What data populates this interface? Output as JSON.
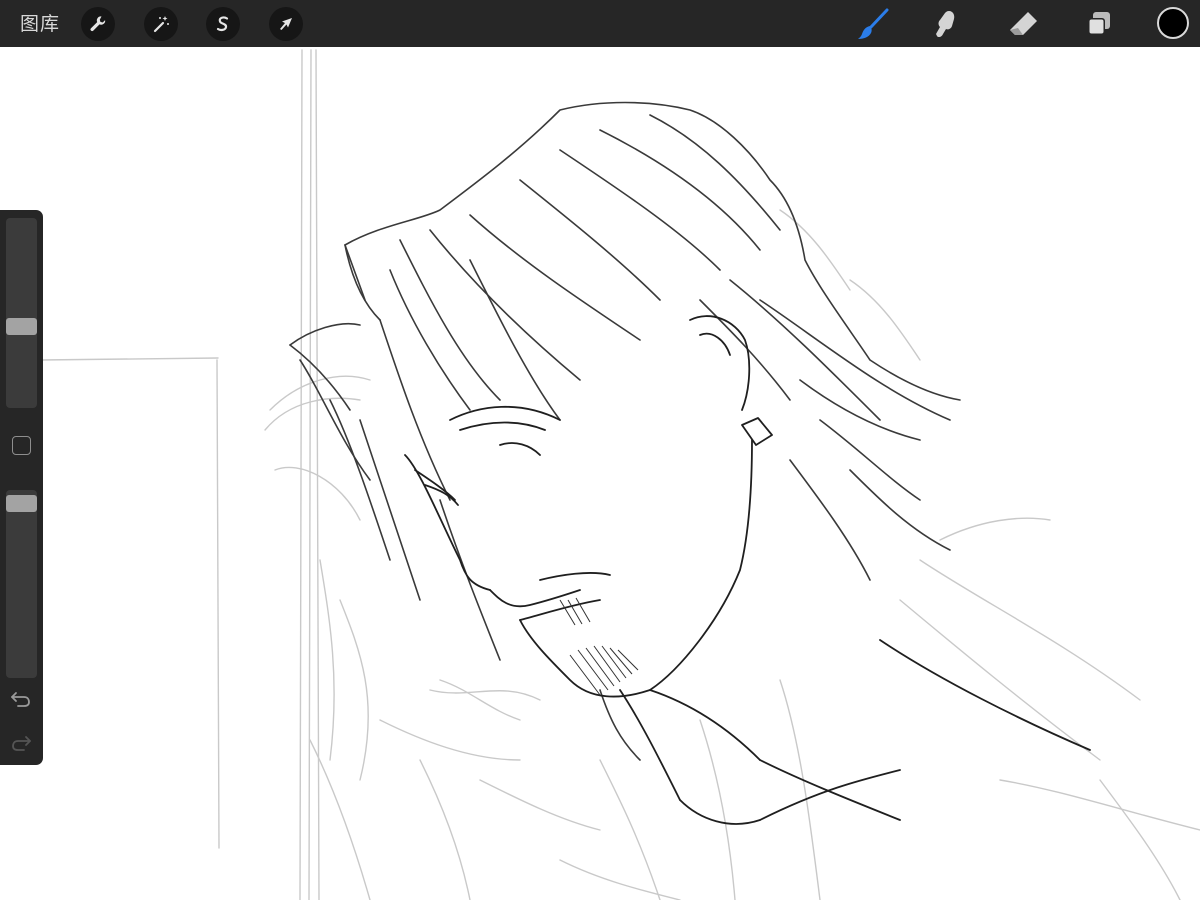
{
  "toolbar": {
    "gallery_label": "图库",
    "left_tools": [
      {
        "name": "actions",
        "icon": "wrench-icon"
      },
      {
        "name": "adjustments",
        "icon": "magic-wand-icon"
      },
      {
        "name": "selection",
        "icon": "selection-s-icon"
      },
      {
        "name": "transform",
        "icon": "arrow-icon"
      }
    ],
    "right_tools": [
      {
        "name": "brush",
        "icon": "brush-icon",
        "active": true
      },
      {
        "name": "smudge",
        "icon": "smudge-finger-icon",
        "active": false
      },
      {
        "name": "eraser",
        "icon": "eraser-icon",
        "active": false
      },
      {
        "name": "layers",
        "icon": "layers-icon",
        "active": false
      }
    ],
    "current_color": "#000000",
    "accent_color": "#2b7de9"
  },
  "sidebar": {
    "brush_size_level": 0.42,
    "opacity_level": 0.97,
    "icons": [
      "modify-square-icon",
      "undo-icon",
      "redo-icon"
    ]
  }
}
